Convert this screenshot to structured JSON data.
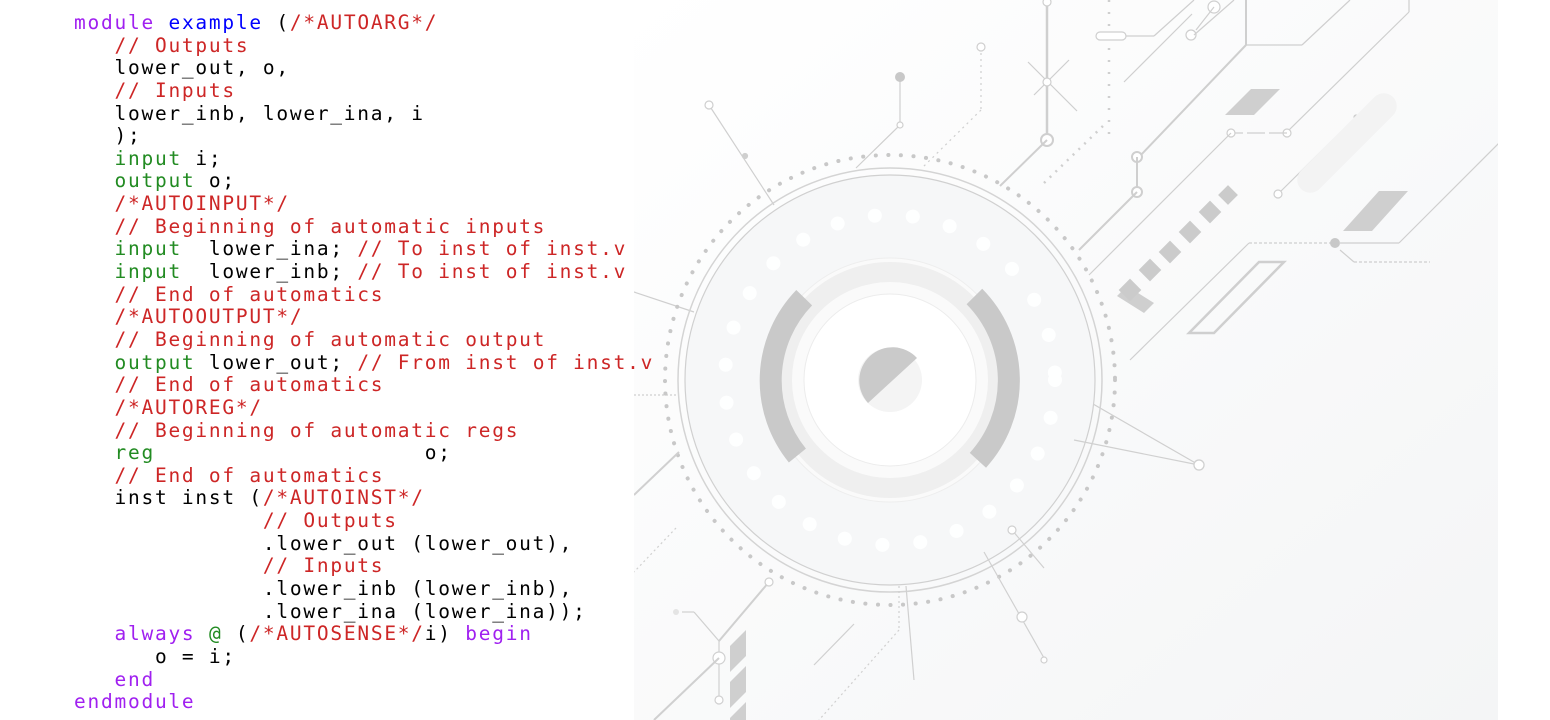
{
  "editor": {
    "language": "verilog",
    "colors": {
      "keyword": "#a020f0",
      "module_name": "#0000ff",
      "comment": "#cd2626",
      "type": "#228b22",
      "text": "#000000",
      "background": "#ffffff"
    },
    "lines": [
      [
        {
          "t": "kw",
          "s": "module"
        },
        {
          "t": "plain",
          "s": " "
        },
        {
          "t": "name",
          "s": "example"
        },
        {
          "t": "plain",
          "s": " ("
        },
        {
          "t": "cmt",
          "s": "/*AUTOARG*/"
        }
      ],
      [
        {
          "t": "plain",
          "s": "   "
        },
        {
          "t": "cmt",
          "s": "// Outputs"
        }
      ],
      [
        {
          "t": "plain",
          "s": "   lower_out, o,"
        }
      ],
      [
        {
          "t": "plain",
          "s": "   "
        },
        {
          "t": "cmt",
          "s": "// Inputs"
        }
      ],
      [
        {
          "t": "plain",
          "s": "   lower_inb, lower_ina, i"
        }
      ],
      [
        {
          "t": "plain",
          "s": "   );"
        }
      ],
      [
        {
          "t": "plain",
          "s": "   "
        },
        {
          "t": "type",
          "s": "input"
        },
        {
          "t": "plain",
          "s": " i;"
        }
      ],
      [
        {
          "t": "plain",
          "s": "   "
        },
        {
          "t": "type",
          "s": "output"
        },
        {
          "t": "plain",
          "s": " o;"
        }
      ],
      [
        {
          "t": "plain",
          "s": "   "
        },
        {
          "t": "cmt",
          "s": "/*AUTOINPUT*/"
        }
      ],
      [
        {
          "t": "plain",
          "s": "   "
        },
        {
          "t": "cmt",
          "s": "// Beginning of automatic inputs"
        }
      ],
      [
        {
          "t": "plain",
          "s": "   "
        },
        {
          "t": "type",
          "s": "input"
        },
        {
          "t": "plain",
          "s": "  lower_ina; "
        },
        {
          "t": "cmt",
          "s": "// To inst of inst.v"
        }
      ],
      [
        {
          "t": "plain",
          "s": "   "
        },
        {
          "t": "type",
          "s": "input"
        },
        {
          "t": "plain",
          "s": "  lower_inb; "
        },
        {
          "t": "cmt",
          "s": "// To inst of inst.v"
        }
      ],
      [
        {
          "t": "plain",
          "s": "   "
        },
        {
          "t": "cmt",
          "s": "// End of automatics"
        }
      ],
      [
        {
          "t": "plain",
          "s": "   "
        },
        {
          "t": "cmt",
          "s": "/*AUTOOUTPUT*/"
        }
      ],
      [
        {
          "t": "plain",
          "s": "   "
        },
        {
          "t": "cmt",
          "s": "// Beginning of automatic output"
        }
      ],
      [
        {
          "t": "plain",
          "s": "   "
        },
        {
          "t": "type",
          "s": "output"
        },
        {
          "t": "plain",
          "s": " lower_out; "
        },
        {
          "t": "cmt",
          "s": "// From inst of inst.v"
        }
      ],
      [
        {
          "t": "plain",
          "s": "   "
        },
        {
          "t": "cmt",
          "s": "// End of automatics"
        }
      ],
      [
        {
          "t": "plain",
          "s": "   "
        },
        {
          "t": "cmt",
          "s": "/*AUTOREG*/"
        }
      ],
      [
        {
          "t": "plain",
          "s": "   "
        },
        {
          "t": "cmt",
          "s": "// Beginning of automatic regs"
        }
      ],
      [
        {
          "t": "plain",
          "s": "   "
        },
        {
          "t": "type",
          "s": "reg"
        },
        {
          "t": "plain",
          "s": "                    o;"
        }
      ],
      [
        {
          "t": "plain",
          "s": "   "
        },
        {
          "t": "cmt",
          "s": "// End of automatics"
        }
      ],
      [
        {
          "t": "plain",
          "s": "   inst inst ("
        },
        {
          "t": "cmt",
          "s": "/*AUTOINST*/"
        }
      ],
      [
        {
          "t": "plain",
          "s": "              "
        },
        {
          "t": "cmt",
          "s": "// Outputs"
        }
      ],
      [
        {
          "t": "plain",
          "s": "              .lower_out (lower_out),"
        }
      ],
      [
        {
          "t": "plain",
          "s": "              "
        },
        {
          "t": "cmt",
          "s": "// Inputs"
        }
      ],
      [
        {
          "t": "plain",
          "s": "              .lower_inb (lower_inb),"
        }
      ],
      [
        {
          "t": "plain",
          "s": "              .lower_ina (lower_ina));"
        }
      ],
      [
        {
          "t": "plain",
          "s": "   "
        },
        {
          "t": "kw",
          "s": "always"
        },
        {
          "t": "plain",
          "s": " "
        },
        {
          "t": "type",
          "s": "@"
        },
        {
          "t": "plain",
          "s": " ("
        },
        {
          "t": "cmt",
          "s": "/*AUTOSENSE*/"
        },
        {
          "t": "plain",
          "s": "i) "
        },
        {
          "t": "kw",
          "s": "begin"
        }
      ],
      [
        {
          "t": "plain",
          "s": "      o = i;"
        }
      ],
      [
        {
          "t": "plain",
          "s": "   "
        },
        {
          "t": "kw",
          "s": "end"
        }
      ],
      [
        {
          "t": "kw",
          "s": "endmodule"
        }
      ]
    ]
  },
  "background": {
    "description": "light gray circuit-board decorative graphic",
    "stroke_color": "#cccccc",
    "fill_color": "#c8c8c8",
    "disc_color": "#f6f7f8"
  }
}
